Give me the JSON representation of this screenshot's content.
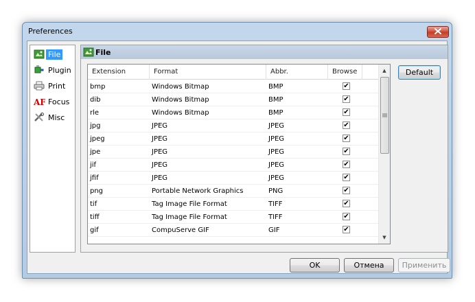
{
  "window": {
    "title": "Preferences"
  },
  "nav": {
    "items": [
      {
        "label": "File",
        "icon": "file-icon",
        "selected": true
      },
      {
        "label": "Plugin",
        "icon": "plugin-icon",
        "selected": false
      },
      {
        "label": "Print",
        "icon": "printer-icon",
        "selected": false
      },
      {
        "label": "Focus",
        "icon": "focus-af-icon",
        "selected": false
      },
      {
        "label": "Misc",
        "icon": "tools-icon",
        "selected": false
      }
    ]
  },
  "panel": {
    "title": "File",
    "default_label": "Default"
  },
  "grid": {
    "columns": [
      "Extension",
      "Format",
      "Abbr.",
      "Browse"
    ],
    "rows": [
      {
        "ext": "bmp",
        "format": "Windows Bitmap",
        "abbr": "BMP",
        "browse": true
      },
      {
        "ext": "dib",
        "format": "Windows Bitmap",
        "abbr": "BMP",
        "browse": true
      },
      {
        "ext": "rle",
        "format": "Windows Bitmap",
        "abbr": "BMP",
        "browse": true
      },
      {
        "ext": "jpg",
        "format": "JPEG",
        "abbr": "JPEG",
        "browse": true
      },
      {
        "ext": "jpeg",
        "format": "JPEG",
        "abbr": "JPEG",
        "browse": true
      },
      {
        "ext": "jpe",
        "format": "JPEG",
        "abbr": "JPEG",
        "browse": true
      },
      {
        "ext": "jif",
        "format": "JPEG",
        "abbr": "JPEG",
        "browse": true
      },
      {
        "ext": "jfif",
        "format": "JPEG",
        "abbr": "JPEG",
        "browse": true
      },
      {
        "ext": "png",
        "format": "Portable Network Graphics",
        "abbr": "PNG",
        "browse": true
      },
      {
        "ext": "tif",
        "format": "Tag Image File Format",
        "abbr": "TIFF",
        "browse": true
      },
      {
        "ext": "tiff",
        "format": "Tag Image File Format",
        "abbr": "TIFF",
        "browse": true
      },
      {
        "ext": "gif",
        "format": "CompuServe GIF",
        "abbr": "GIF",
        "browse": true
      }
    ]
  },
  "buttons": {
    "ok": "OK",
    "cancel": "Отмена",
    "apply": "Применить"
  }
}
